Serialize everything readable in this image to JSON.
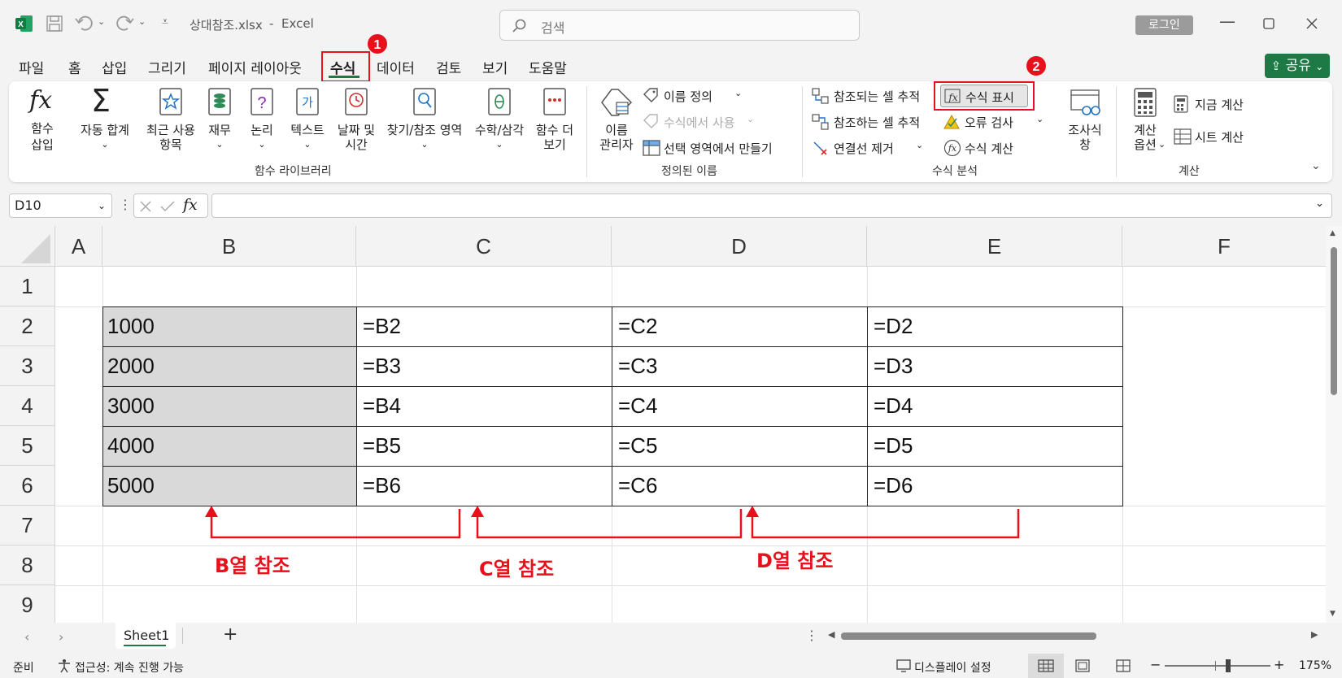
{
  "title": {
    "filename": "상대참조.xlsx",
    "separator": "-",
    "app": "Excel",
    "search_placeholder": "검색",
    "login": "로그인"
  },
  "menu": {
    "tabs": [
      "파일",
      "홈",
      "삽입",
      "그리기",
      "페이지 레이아웃",
      "수식",
      "데이터",
      "검토",
      "보기",
      "도움말"
    ],
    "active": "수식",
    "share": "공유"
  },
  "ribbon": {
    "fx_insert": [
      "함수",
      "삽입"
    ],
    "autosum": "자동 합계",
    "recent": [
      "최근 사용",
      "항목"
    ],
    "finance": "재무",
    "logic": "논리",
    "text": "텍스트",
    "datetime": [
      "날짜 및",
      "시간"
    ],
    "lookup": "찾기/참조 영역",
    "math": "수학/삼각",
    "more": [
      "함수 더",
      "보기"
    ],
    "library_group": "함수 라이브러리",
    "name_mgr": [
      "이름",
      "관리자"
    ],
    "define_name": "이름 정의",
    "use_in_formula": "수식에서 사용",
    "create_from_sel": "선택 영역에서 만들기",
    "names_group": "정의된 이름",
    "trace_prec": "참조되는 셀 추적",
    "trace_dep": "참조하는 셀 추적",
    "remove_arrows": "연결선 제거",
    "show_formulas": "수식 표시",
    "error_check": "오류 검사",
    "evaluate": "수식 계산",
    "audit_group": "수식 분석",
    "watch": [
      "조사식",
      "창"
    ],
    "calc_opts": [
      "계산",
      "옵션"
    ],
    "calc_now": "지금 계산",
    "calc_sheet": "시트 계산",
    "calc_group": "계산",
    "badge1": "1",
    "badge2": "2"
  },
  "formula_bar": {
    "cell_ref": "D10",
    "fx": "fx",
    "content": ""
  },
  "grid": {
    "columns": [
      "A",
      "B",
      "C",
      "D",
      "E",
      "F"
    ],
    "rows": [
      "1",
      "2",
      "3",
      "4",
      "5",
      "6",
      "7",
      "8",
      "9"
    ],
    "table": [
      [
        "1000",
        "=B2",
        "=C2",
        "=D2"
      ],
      [
        "2000",
        "=B3",
        "=C3",
        "=D3"
      ],
      [
        "3000",
        "=B4",
        "=C4",
        "=D4"
      ],
      [
        "4000",
        "=B5",
        "=C5",
        "=D5"
      ],
      [
        "5000",
        "=B6",
        "=C6",
        "=D6"
      ]
    ]
  },
  "annotations": {
    "b_ref": "B열 참조",
    "c_ref": "C열 참조",
    "d_ref": "D열 참조",
    "color": "#e8101b"
  },
  "sheets": {
    "tabs": [
      "Sheet1"
    ],
    "active": "Sheet1"
  },
  "status": {
    "ready": "준비",
    "accessibility": "접근성: 계속 진행 가능",
    "display_settings": "디스플레이 설정",
    "zoom": "175%"
  },
  "colors": {
    "excel_green": "#1e7a45",
    "highlight_red": "#e8101b",
    "shaded_cell": "#d9d9d9"
  }
}
